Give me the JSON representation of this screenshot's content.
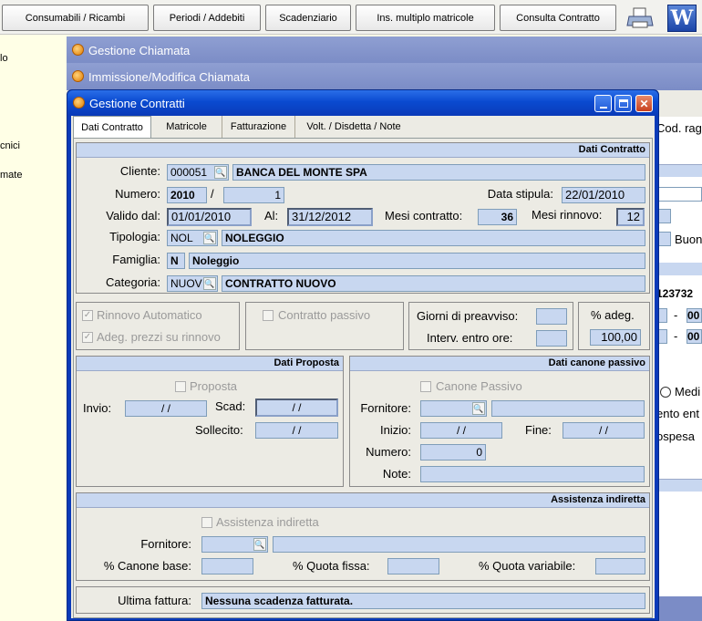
{
  "toolbar": {
    "buttons": [
      "Consumabili / Ricambi",
      "Periodi / Addebiti",
      "Scadenziario",
      "Ins. multiplo matricole",
      "Consulta Contratto"
    ],
    "printer_icon": "printer-icon",
    "word_icon_label": "W"
  },
  "left_sidebar": [
    "lo",
    "cnici",
    "mate"
  ],
  "background_windows": {
    "gestione_chiamata": "Gestione Chiamata",
    "immissione_chiamata": "Immissione/Modifica Chiamata"
  },
  "behind_right": {
    "cod_rag": "Cod. rag",
    "buon": "Buon",
    "code": "123732",
    "dash1": "-",
    "dash2": "-",
    "val1": "00",
    "val2": "00",
    "medi": "Medi",
    "ento": "ento ent",
    "ospesa": "ospesa"
  },
  "dialog": {
    "title": "Gestione Contratti",
    "tabs": [
      "Dati Contratto",
      "Matricole",
      "Fatturazione",
      "Volt. / Disdetta / Note"
    ],
    "dati_contratto": {
      "header": "Dati Contratto",
      "cliente_label": "Cliente:",
      "cliente_code": "000051",
      "cliente_name": "BANCA DEL MONTE SPA",
      "numero_label": "Numero:",
      "numero_year": "2010",
      "numero_sep": "/",
      "numero_num": "1",
      "data_stipula_label": "Data stipula:",
      "data_stipula": "22/01/2010",
      "valido_dal_label": "Valido dal:",
      "valido_dal": "01/01/2010",
      "al_label": "Al:",
      "al": "31/12/2012",
      "mesi_contratto_label": "Mesi contratto:",
      "mesi_contratto": "36",
      "mesi_rinnovo_label": "Mesi rinnovo:",
      "mesi_rinnovo": "12",
      "tipologia_label": "Tipologia:",
      "tipologia_code": "NOL",
      "tipologia_name": "NOLEGGIO",
      "famiglia_label": "Famiglia:",
      "famiglia_code": "N",
      "famiglia_name": "Noleggio",
      "categoria_label": "Categoria:",
      "categoria_code": "NUOV",
      "categoria_name": "CONTRATTO NUOVO"
    },
    "options": {
      "rinnovo_automatico": "Rinnovo Automatico",
      "adeg_prezzi": "Adeg. prezzi su rinnovo",
      "contratto_passivo": "Contratto passivo",
      "giorni_preavviso_label": "Giorni di preavviso:",
      "interv_entro_label": "Interv. entro ore:",
      "adeg_label": "% adeg.",
      "adeg_value": "100,00"
    },
    "dati_proposta": {
      "header": "Dati Proposta",
      "proposta": "Proposta",
      "invio_label": "Invio:",
      "invio": " /  /",
      "scad_label": "Scad:",
      "scad": " /  /",
      "sollecito_label": "Sollecito:",
      "sollecito": " /  /"
    },
    "canone_passivo": {
      "header": "Dati canone passivo",
      "canone_passivo": "Canone Passivo",
      "fornitore_label": "Fornitore:",
      "inizio_label": "Inizio:",
      "inizio": " /  /",
      "fine_label": "Fine:",
      "fine": " /  /",
      "numero_label": "Numero:",
      "numero": "0",
      "note_label": "Note:"
    },
    "assistenza": {
      "header": "Assistenza indiretta",
      "checkbox": "Assistenza indiretta",
      "fornitore_label": "Fornitore:",
      "canone_base_label": "% Canone base:",
      "quota_fissa_label": "% Quota fissa:",
      "quota_variabile_label": "% Quota variabile:"
    },
    "ultima_fattura_label": "Ultima fattura:",
    "ultima_fattura": "Nessuna scadenza fatturata."
  },
  "colors": {
    "field_bg": "#c8d7f0",
    "title_blue": "#0a3ab8",
    "bg_window_title": "#7b8cc6"
  }
}
